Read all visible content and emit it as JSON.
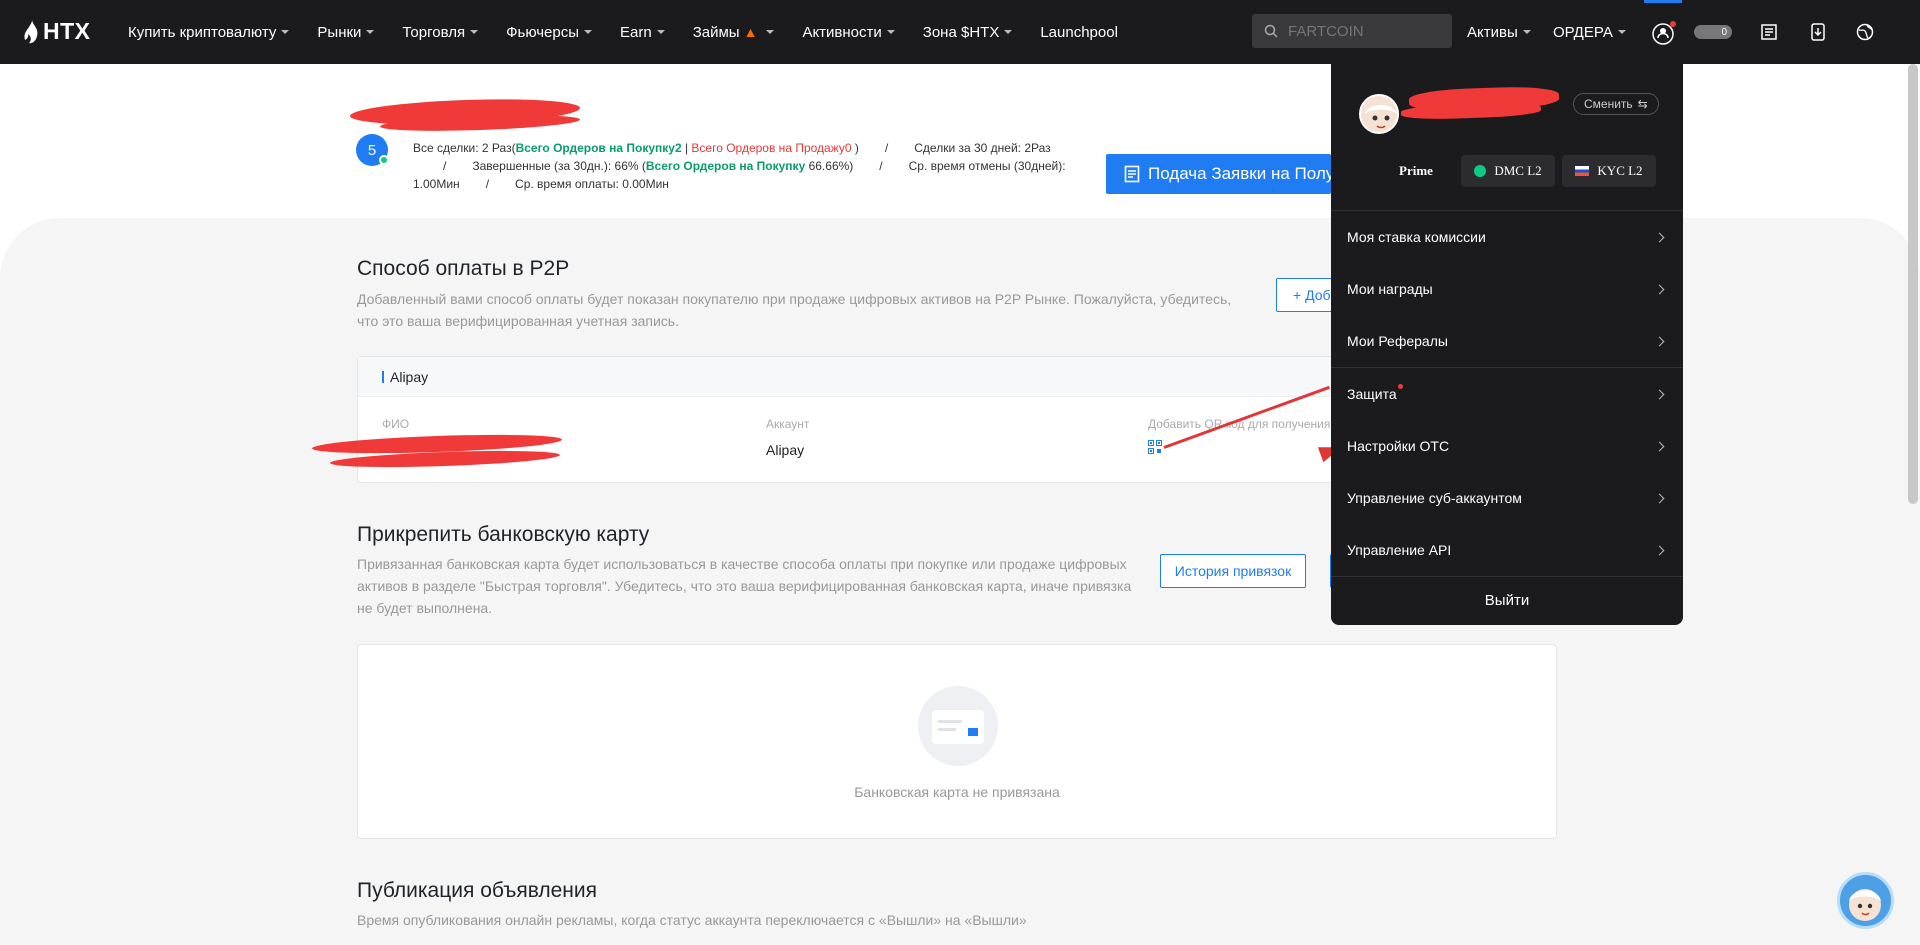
{
  "nav": {
    "logo": "HTX",
    "items": [
      {
        "label": "Купить криптовалюту",
        "caret": true
      },
      {
        "label": "Рынки",
        "caret": true
      },
      {
        "label": "Торговля",
        "caret": true
      },
      {
        "label": "Фьючерсы",
        "caret": true
      },
      {
        "label": "Earn",
        "caret": true
      },
      {
        "label": "Займы",
        "caret": true,
        "fire": true
      },
      {
        "label": "Активности",
        "caret": true
      },
      {
        "label": "Зона $HTX",
        "caret": true
      },
      {
        "label": "Launchpool",
        "caret": false
      }
    ],
    "search_placeholder": "FARTCOIN",
    "assets_label": "Активы",
    "orders_label": "ОРДЕРА",
    "chip_text": "0"
  },
  "profile": {
    "level": "5",
    "stats": {
      "all_deals_prefix": "Все сделки: 2 Раз(",
      "buy_orders_label": "Всего Ордеров на Покупку",
      "buy_orders_value": "2",
      "divider": " | ",
      "sell_orders_label": "Всего Ордеров на Продажу",
      "sell_orders_value": "0",
      "close_paren": " )",
      "deals_30d": "Сделки за 30 дней: 2Раз",
      "completed_30d_prefix": "Завершенные (за 30дн.): 66%  (",
      "buy_orders_label_2": "Всего Ордеров на Покупку",
      "buy_orders_pct": " 66.66%)",
      "avg_cancel_time": "Ср. время отмены (30дней): 1.00Мин",
      "avg_pay_time": "Ср. время оплаты: 0.00Мин",
      "slash": "/"
    },
    "submit_button": "Подача Заявки на Получение"
  },
  "p2p_payment": {
    "title": "Способ оплаты в P2P",
    "description": "Добавленный вами способ оплаты будет показан покупателю при продаже цифровых активов на P2P Рынке. Пожалуйста, убедитесь, что это ваша верифицированная учетная запись.",
    "add_button": "+ Добавить",
    "method_name": "Alipay",
    "col_name_label": "ФИО",
    "col_account_label": "Аккаунт",
    "col_account_value": "Alipay",
    "col_qr_label": "Добавить QR код для получения"
  },
  "bank_card": {
    "title": "Прикрепить банковскую карту",
    "description": "Привязанная банковская карта будет использоваться в качестве способа оплаты при покупке или продаже цифровых активов в разделе \"Быстрая торговля\". Убедитесь, что это ваша верифицированная банковская карта, иначе привязка не будет выполнена.",
    "history_button": "История привязок",
    "empty_text": "Банковская карта не привязана"
  },
  "publish": {
    "title": "Публикация объявления",
    "description": "Время опубликования онлайн рекламы, когда статус аккаунта переключается с «Вышли» на «Вышли»"
  },
  "dropdown": {
    "switch_label": "Сменить",
    "prime_label": "Prime",
    "dmc_label": "DMC L2",
    "kyc_label": "KYC L2",
    "items": [
      {
        "label": "Моя ставка комиссии"
      },
      {
        "label": "Мои награды"
      },
      {
        "label": "Мои Рефералы"
      },
      {
        "label": "Защита",
        "dot": true
      },
      {
        "label": "Настройки OTC"
      },
      {
        "label": "Управление суб-аккаунтом"
      },
      {
        "label": "Управление API"
      }
    ],
    "logout": "Выйти"
  },
  "colors": {
    "accent": "#1f7cf2",
    "buy": "#0a9d6b",
    "sell": "#e63a3a",
    "nav_bg": "#1b1b1d"
  }
}
